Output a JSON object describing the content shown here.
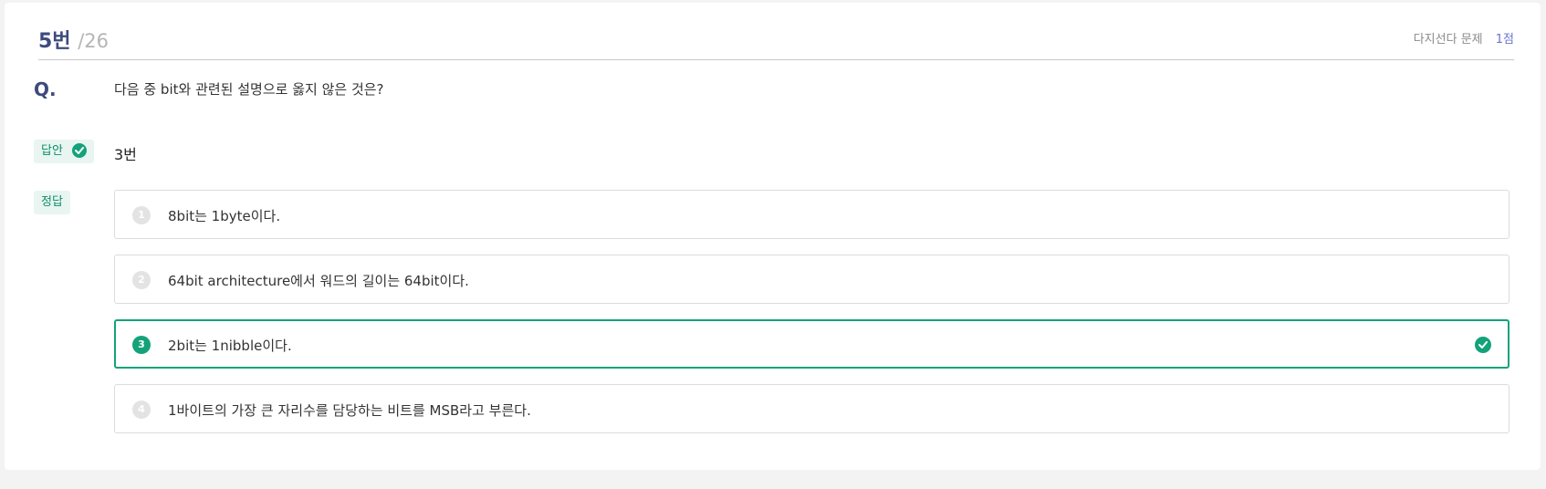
{
  "header": {
    "number": "5번",
    "total": "/26",
    "question_type": "다지선다 문제",
    "points": "1점"
  },
  "question": {
    "label": "Q.",
    "text": "다음 중 bit와 관련된 설명으로 옳지 않은 것은?"
  },
  "answer": {
    "label": "답안",
    "value": "3번",
    "status_icon": "check-circle-icon"
  },
  "correct": {
    "label": "정답"
  },
  "options": [
    {
      "number": "1",
      "text": "8bit는 1byte이다."
    },
    {
      "number": "2",
      "text": "64bit architecture에서 워드의 길이는 64bit이다."
    },
    {
      "number": "3",
      "text": "2bit는 1nibble이다.",
      "selected": true
    },
    {
      "number": "4",
      "text": "1바이트의 가장 큰 자리수를 담당하는 비트를 MSB라고 부른다."
    }
  ],
  "colors": {
    "accent_green": "#14a27a",
    "title_navy": "#3d4a7e",
    "points_blue": "#6a74c9"
  }
}
